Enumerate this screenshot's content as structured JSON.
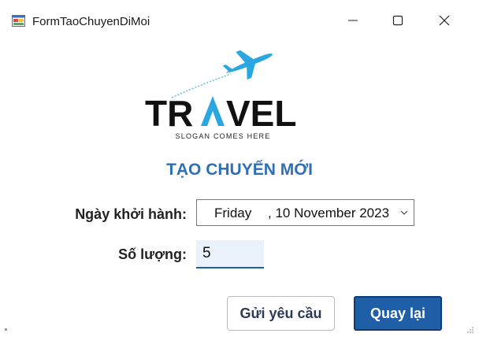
{
  "window": {
    "title": "FormTaoChuyenDiMoi"
  },
  "logo": {
    "wordmark": "TRAVEL",
    "slogan": "SLOGAN COMES HERE",
    "brand_dark": "#111111",
    "brand_accent": "#2aa6e0"
  },
  "form": {
    "heading": "TẠO CHUYẾN MỚI",
    "date_label": "Ngày khởi hành:",
    "date_day": "Friday",
    "date_rest": ", 10 November 2023",
    "quantity_label": "Số lượng:",
    "quantity_value": "5"
  },
  "buttons": {
    "send_label": "Gửi yêu cầu",
    "back_label": "Quay lại"
  },
  "colors": {
    "heading": "#2f6fb5",
    "primary_button": "#1f5fa8",
    "input_focus_bg": "#eaf2fb"
  }
}
